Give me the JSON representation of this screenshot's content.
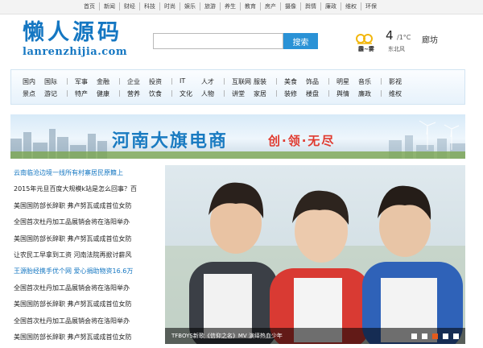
{
  "top_nav": [
    "首页",
    "新闻",
    "财经",
    "科技",
    "时尚",
    "娱乐",
    "旅游",
    "养生",
    "教育",
    "房产",
    "摄像",
    "舆情",
    "廉政",
    "维权",
    "环保"
  ],
  "logo": {
    "cn": "懒人源码",
    "en": "lanrenzhijia.com"
  },
  "search": {
    "placeholder": "",
    "button": "搜索"
  },
  "weather": {
    "temp": "4",
    "unit": "/1°C",
    "city": "廊坊",
    "desc": "霾~雾",
    "wind": "东北风",
    "icon": "weather-haze-icon"
  },
  "nav": {
    "row1": [
      "国内",
      "国际",
      "军事",
      "金融",
      "企业",
      "投资",
      "IT",
      "人才",
      "互联网",
      "服装",
      "美食",
      "饰品",
      "明星",
      "音乐",
      "影视"
    ],
    "row2": [
      "景点",
      "游记",
      "特产",
      "健康",
      "营养",
      "饮食",
      "文化",
      "人物",
      "讲堂",
      "家居",
      "装修",
      "楼盘",
      "舆情",
      "廉政",
      "维权"
    ]
  },
  "banner": {
    "title": "河南大旗电商",
    "slogan": "创·领·无尽"
  },
  "news": [
    {
      "text": "云南临沧边境一线所有村寨居民原籍上",
      "highlight": true
    },
    {
      "text": "2015年元旦百度大规模k站是怎么回事？百",
      "highlight": false
    },
    {
      "text": "美国国防部长辞职 弗卢努瓦或成首位女防",
      "highlight": false
    },
    {
      "text": "全国首次杜丹加工品展销会将在洛阳举办",
      "highlight": false
    },
    {
      "text": "美国国防部长辞职 弗卢努瓦或成首位女防",
      "highlight": false
    },
    {
      "text": "让农民工早拿到工资 河南法院再掀讨薪风",
      "highlight": false
    },
    {
      "text": "王源胎经携手优个网 爱心捐助物资16.6万",
      "highlight": true
    },
    {
      "text": "全国首次杜丹加工品展销会将在洛阳举办",
      "highlight": false
    },
    {
      "text": "美国国防部长辞职 弗卢努瓦或成首位女防",
      "highlight": false
    },
    {
      "text": "全国首次杜丹加工品展销会将在洛阳举办",
      "highlight": false
    },
    {
      "text": "美国国防部长辞职 弗卢努瓦或成首位女防",
      "highlight": false
    }
  ],
  "photo": {
    "caption": "TFBOYS新歌《信仰之名》MV 演绎热血少年",
    "slides": 5,
    "active_slide": 2
  },
  "colors": {
    "brand": "#1577c2",
    "search_button": "#2a92d6",
    "active_dot": "#e45b1c",
    "slogan": "#e03a2f"
  }
}
